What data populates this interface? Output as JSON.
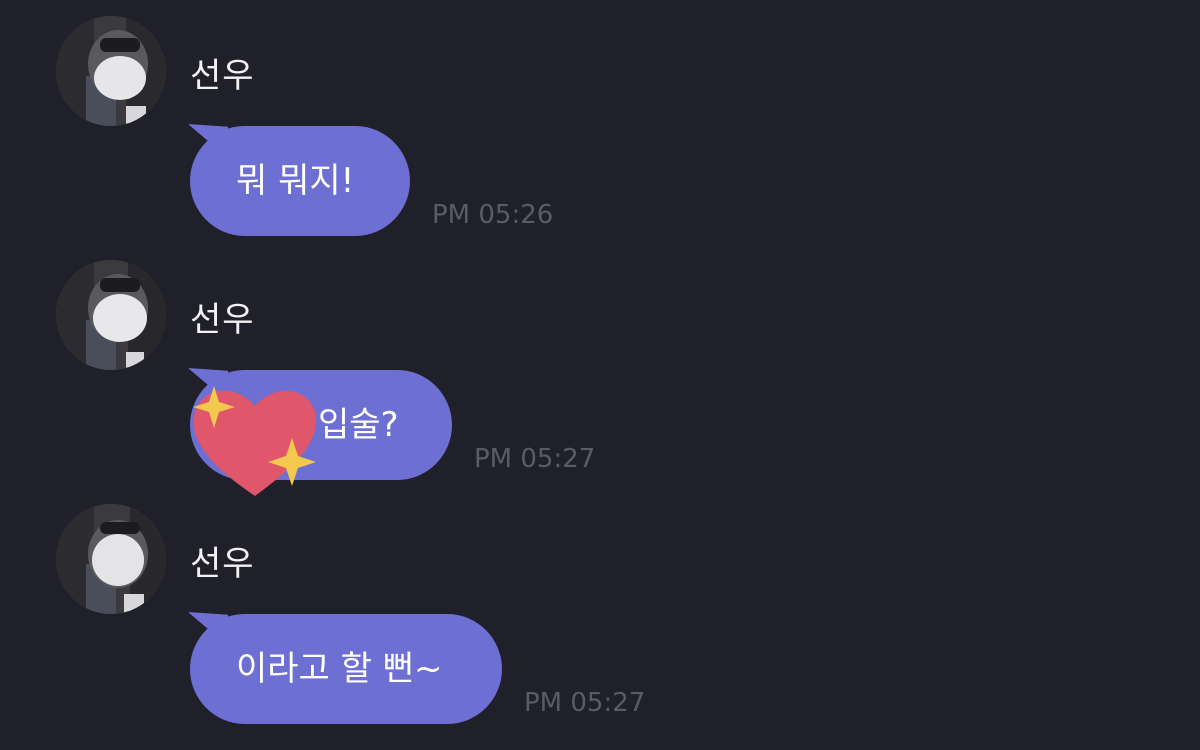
{
  "messages": [
    {
      "sender": "선우",
      "text": "뭐 뭐지!",
      "time": "PM 05:26",
      "has_sticker": false
    },
    {
      "sender": "선우",
      "text": "입술?",
      "time": "PM 05:27",
      "has_sticker": true,
      "sticker": "sparkling-heart-icon"
    },
    {
      "sender": "선우",
      "text": "이라고 할 뻔~",
      "time": "PM 05:27",
      "has_sticker": false
    }
  ],
  "colors": {
    "background": "#20202a",
    "bubble": "#6e6fd3",
    "heart": "#e0566a",
    "sparkle": "#f2c94c",
    "timestamp": "#5b5b63"
  }
}
